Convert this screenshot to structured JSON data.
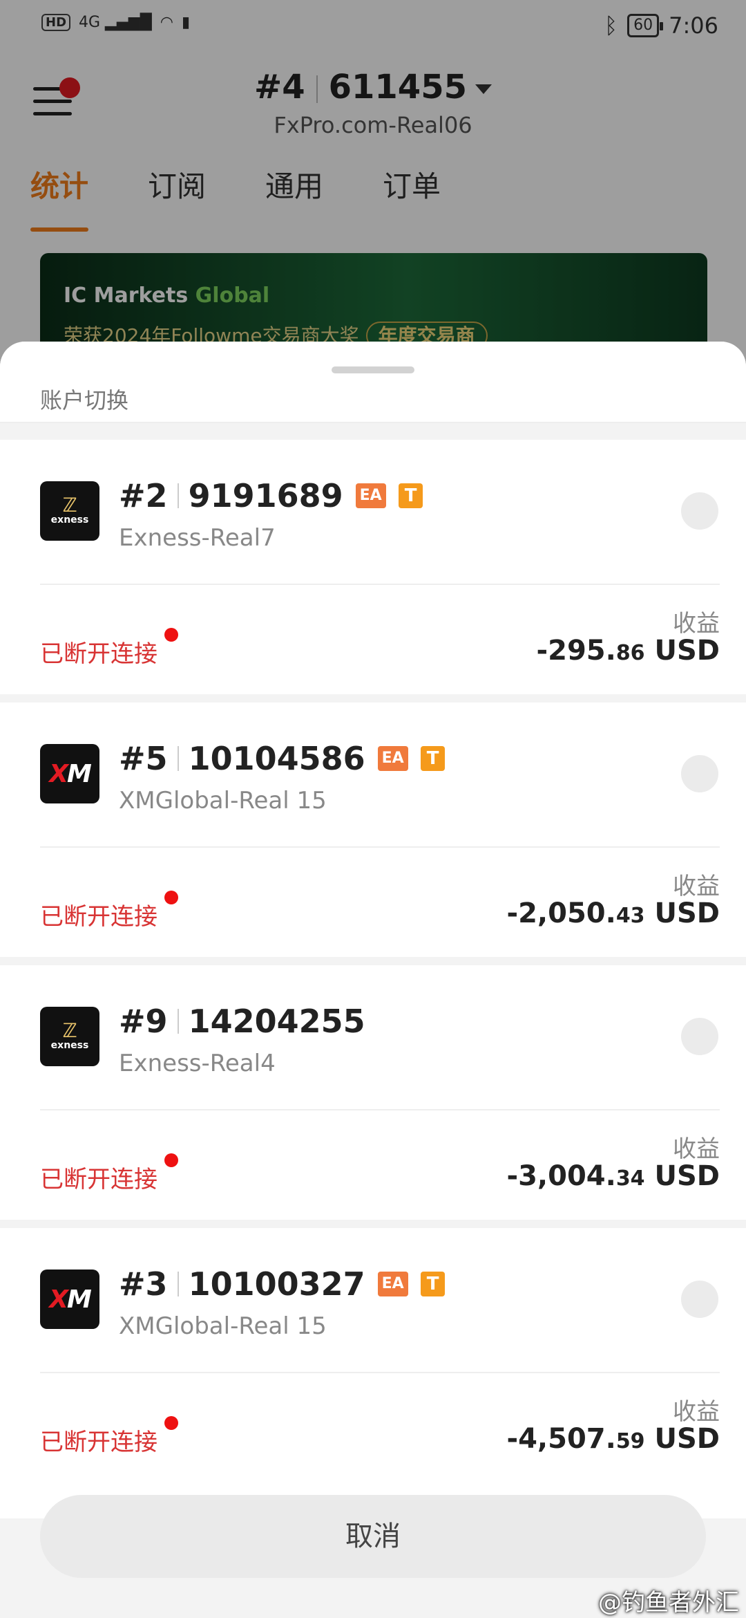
{
  "statusbar": {
    "network": "HD",
    "signal": "4G",
    "battery": "60",
    "time": "7:06"
  },
  "header": {
    "account_index": "#4",
    "account_number": "611455",
    "server": "FxPro.com-Real06"
  },
  "tabs": [
    "统计",
    "订阅",
    "通用",
    "订单"
  ],
  "banner": {
    "brand_a": "IC Markets",
    "brand_b": "Global",
    "line": "荣获2024年Followme交易商大奖",
    "award": "年度交易商"
  },
  "sheet": {
    "title": "账户切换",
    "cancel_label": "取消"
  },
  "accounts": [
    {
      "index": "#2",
      "number": "9191689",
      "server": "Exness-Real7",
      "broker": "exness",
      "badges": [
        "EA",
        "T"
      ],
      "status": "已断开连接",
      "profit_label": "收益",
      "profit_int": "-295.",
      "profit_dec": "86",
      "currency": "USD"
    },
    {
      "index": "#5",
      "number": "10104586",
      "server": "XMGlobal-Real 15",
      "broker": "XM",
      "badges": [
        "EA",
        "T"
      ],
      "status": "已断开连接",
      "profit_label": "收益",
      "profit_int": "-2,050.",
      "profit_dec": "43",
      "currency": "USD"
    },
    {
      "index": "#9",
      "number": "14204255",
      "server": "Exness-Real4",
      "broker": "exness",
      "badges": [],
      "status": "已断开连接",
      "profit_label": "收益",
      "profit_int": "-3,004.",
      "profit_dec": "34",
      "currency": "USD"
    },
    {
      "index": "#3",
      "number": "10100327",
      "server": "XMGlobal-Real 15",
      "broker": "XM",
      "badges": [
        "EA",
        "T"
      ],
      "status": "已断开连接",
      "profit_label": "收益",
      "profit_int": "-4,507.",
      "profit_dec": "59",
      "currency": "USD"
    }
  ],
  "colors": {
    "accent": "#f07c1a",
    "disconnected": "#d83434",
    "badge_ea": "#f07a3c",
    "badge_t": "#f59a1b"
  },
  "watermark": "@钓鱼者外汇"
}
